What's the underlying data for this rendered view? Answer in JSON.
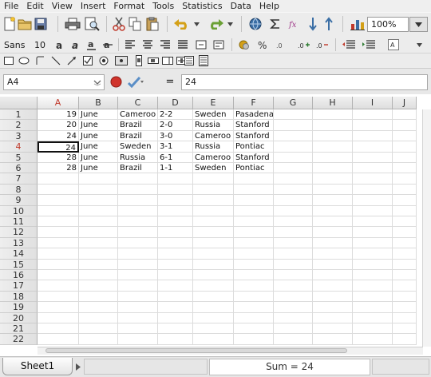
{
  "menu": [
    "File",
    "Edit",
    "View",
    "Insert",
    "Format",
    "Tools",
    "Statistics",
    "Data",
    "Help"
  ],
  "toolbar": {
    "row1_icons": [
      "new-document-icon",
      "open-icon",
      "save-icon",
      "print-icon",
      "print-preview-icon",
      "cut-icon",
      "copy-icon",
      "paste-icon",
      "undo-icon",
      "redo-icon",
      "hyperlink-icon",
      "sum-icon",
      "function-icon",
      "sort-ascending-icon",
      "sort-descending-icon",
      "chart-icon"
    ],
    "zoom": "100%",
    "font_name": "Sans",
    "font_size": "10"
  },
  "formula_bar": {
    "cell_ref": "A4",
    "equals": "=",
    "value": "24"
  },
  "columns": [
    "A",
    "B",
    "C",
    "D",
    "E",
    "F",
    "G",
    "H",
    "I",
    "J"
  ],
  "rows": [
    "1",
    "2",
    "3",
    "4",
    "5",
    "6",
    "7",
    "8",
    "9",
    "10",
    "11",
    "12",
    "13",
    "14",
    "15",
    "16",
    "17",
    "18",
    "19",
    "20",
    "21",
    "22"
  ],
  "active_cell": {
    "row": 4,
    "col": "A"
  },
  "data_rows": [
    [
      "19",
      "June",
      "Cameroo",
      "2-2",
      "Sweden",
      "Pasadena"
    ],
    [
      "20",
      "June",
      "Brazil",
      "2-0",
      "Russia",
      "Stanford"
    ],
    [
      "24",
      "June",
      "Brazil",
      "3-0",
      "Cameroo",
      "Stanford"
    ],
    [
      "24",
      "June",
      "Sweden",
      "3-1",
      "Russia",
      "Pontiac"
    ],
    [
      "28",
      "June",
      "Russia",
      "6-1",
      "Cameroo",
      "Stanford"
    ],
    [
      "28",
      "June",
      "Brazil",
      "1-1",
      "Sweden",
      "Pontiac"
    ]
  ],
  "status": {
    "sheet_tab": "Sheet1",
    "sum": "Sum = 24"
  },
  "colors": {
    "active_header": "#c0392b",
    "grid_line": "#dcdcdc"
  }
}
